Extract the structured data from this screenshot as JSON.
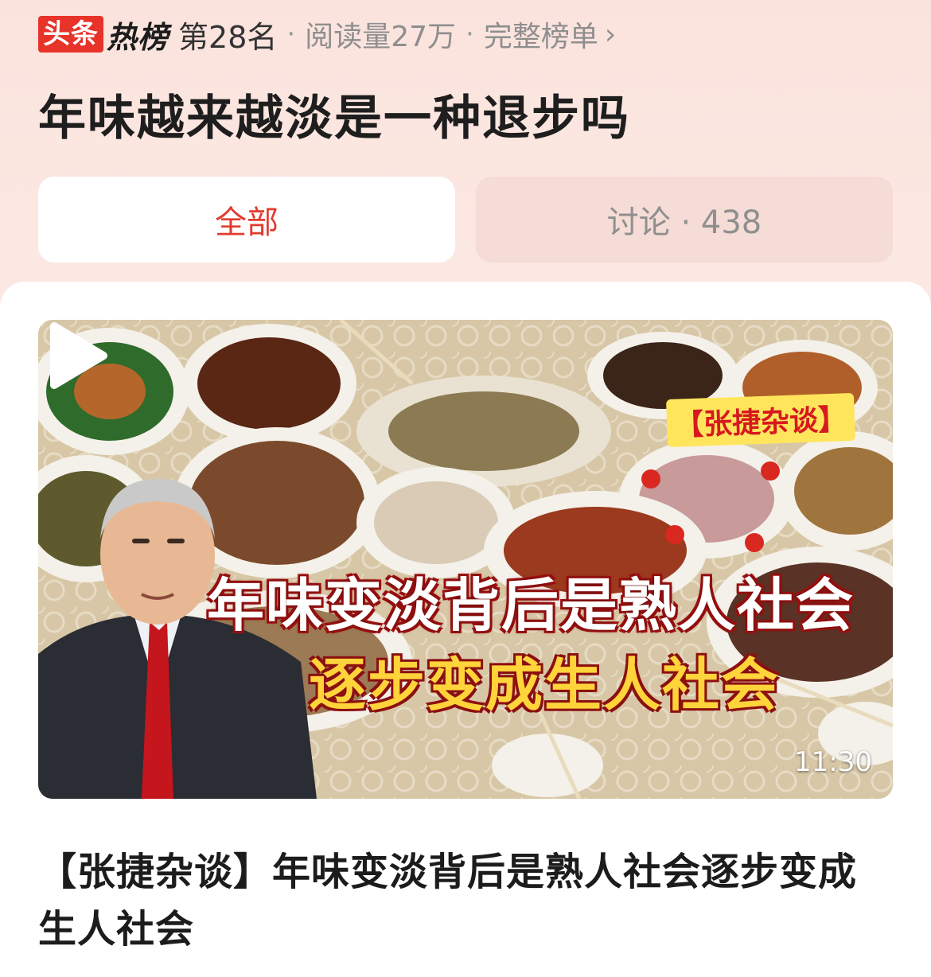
{
  "header": {
    "brand_badge": "头条",
    "brand_hot": "热榜",
    "rank": "第28名",
    "separator": "·",
    "read_count": "阅读量27万",
    "full_list": "完整榜单",
    "chevron": "›"
  },
  "topic": {
    "title": "年味越来越淡是一种退步吗"
  },
  "tabs": [
    {
      "label": "全部",
      "active": true
    },
    {
      "label": "讨论 · 438",
      "active": false
    }
  ],
  "video": {
    "tag": "【张捷杂谈】",
    "caption_line1": "年味变淡背后是熟人社会",
    "caption_line2": "逐步变成生人社会",
    "duration": "11:30",
    "play_icon": "play-icon"
  },
  "article": {
    "title": "【张捷杂谈】年味变淡背后是熟人社会逐步变成生人社会"
  },
  "colors": {
    "accent": "#e23b2f",
    "badge_red": "#e7332a",
    "tab_inactive_bg": "#f5dcd6"
  }
}
